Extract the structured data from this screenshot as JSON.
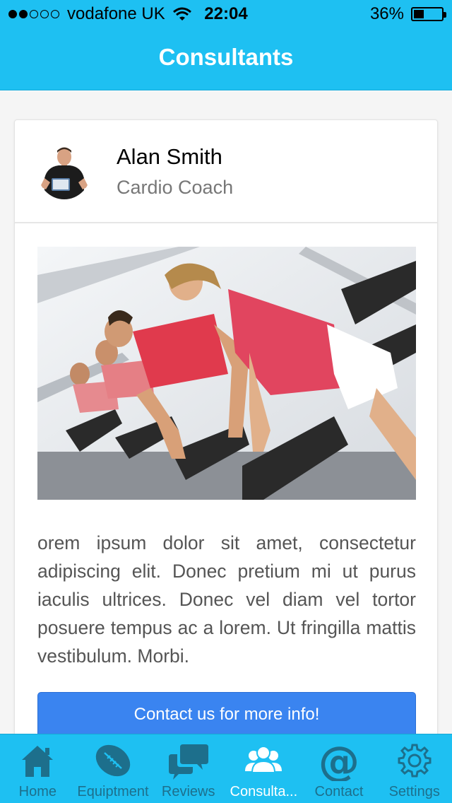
{
  "status_bar": {
    "signal_dots": [
      true,
      true,
      false,
      false,
      false
    ],
    "carrier": "vodafone UK",
    "time": "22:04",
    "battery": "36%",
    "battery_level": 0.36
  },
  "header": {
    "title": "Consultants"
  },
  "card": {
    "name": "Alan Smith",
    "role": "Cardio Coach",
    "description": "orem ipsum dolor sit amet, consectetur adipiscing elit. Donec pretium mi ut purus iaculis ultrices. Donec vel diam vel tortor posuere tempus ac a lorem. Ut fringilla mattis vestibulum. Morbi.",
    "cta_label": "Contact us for more info!"
  },
  "tabs": [
    {
      "label": "Home",
      "icon": "home-icon",
      "active": false
    },
    {
      "label": "Equiptment",
      "icon": "football-icon",
      "active": false
    },
    {
      "label": "Reviews",
      "icon": "chat-bubbles-icon",
      "active": false
    },
    {
      "label": "Consulta...",
      "icon": "people-icon",
      "active": true
    },
    {
      "label": "Contact",
      "icon": "at-icon",
      "active": false
    },
    {
      "label": "Settings",
      "icon": "gear-icon",
      "active": false
    }
  ],
  "colors": {
    "accent": "#1ec0f2",
    "button": "#3a84f0",
    "tab_inactive": "#1d6f8c",
    "tab_active": "#ffffff"
  }
}
